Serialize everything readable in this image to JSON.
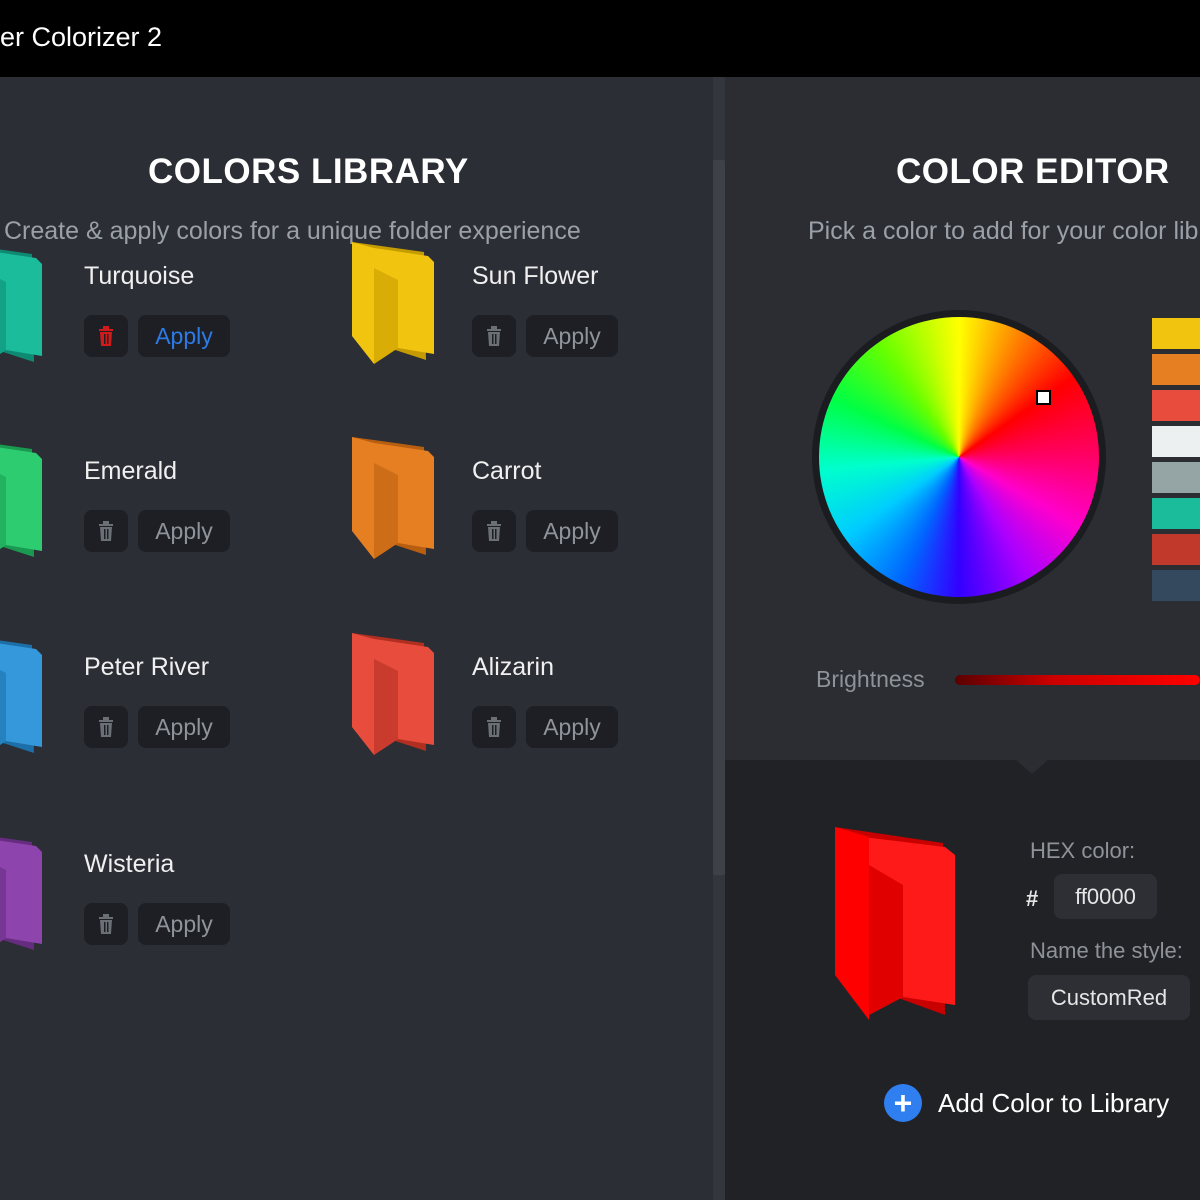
{
  "window": {
    "title": "er Colorizer 2"
  },
  "library": {
    "title": "COLORS LIBRARY",
    "subtitle": "Create & apply colors for a unique folder experience",
    "items": [
      {
        "name": "Turquoise",
        "apply_label": "Apply",
        "color": "#1abc9c",
        "dark": "#0f8a72",
        "active": true
      },
      {
        "name": "Sun Flower",
        "apply_label": "Apply",
        "color": "#f1c40f",
        "dark": "#c49b00",
        "active": false
      },
      {
        "name": "Emerald",
        "apply_label": "Apply",
        "color": "#2ecc71",
        "dark": "#1a9a50",
        "active": false
      },
      {
        "name": "Carrot",
        "apply_label": "Apply",
        "color": "#e67e22",
        "dark": "#b85e10",
        "active": false
      },
      {
        "name": "Peter River",
        "apply_label": "Apply",
        "color": "#3498db",
        "dark": "#1c6fa8",
        "active": false
      },
      {
        "name": "Alizarin",
        "apply_label": "Apply",
        "color": "#e74c3c",
        "dark": "#b02f20",
        "active": false
      },
      {
        "name": "Wisteria",
        "apply_label": "Apply",
        "color": "#8e44ad",
        "dark": "#662c80",
        "active": false
      }
    ]
  },
  "editor": {
    "title": "COLOR EDITOR",
    "subtitle": "Pick a color to add for your color lib",
    "swatches": [
      "#f1c40f",
      "#e67e22",
      "#e74c3c",
      "#ecf0f1",
      "#95a5a6",
      "#1abc9c",
      "#c0392b",
      "#34495e"
    ],
    "brightness_label": "Brightness",
    "hex_label": "HEX color:",
    "hash": "#",
    "hex_value": "ff0000",
    "name_label": "Name the style:",
    "name_value": "CustomRed",
    "add_label": "Add Color to Library",
    "add_icon": "+",
    "preview_color": "#ff0000"
  }
}
